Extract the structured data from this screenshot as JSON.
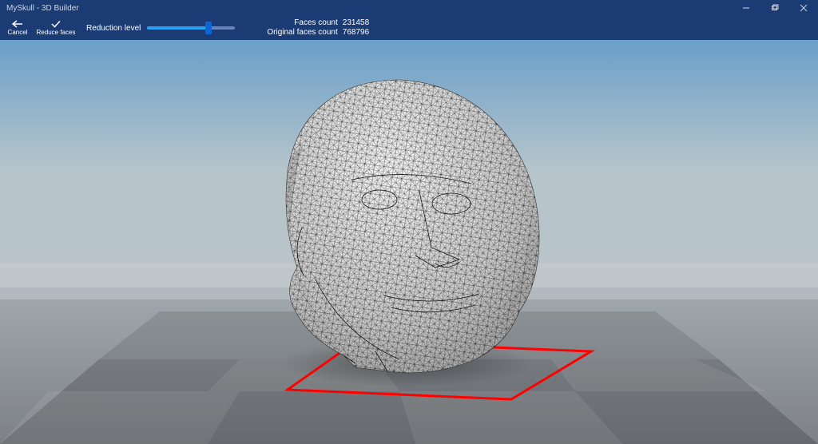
{
  "window": {
    "title": "MySkull - 3D Builder"
  },
  "toolbar": {
    "cancel_label": "Cancel",
    "accept_label": "Reduce faces",
    "slider_label": "Reduction level",
    "slider_percent": 70
  },
  "stats": {
    "faces_label": "Faces count",
    "faces_value": "231458",
    "original_label": "Original faces count",
    "original_value": "768796"
  },
  "scene": {
    "sky_top": "#6a9fc9",
    "sky_bottom": "#b7c5cb",
    "ground_near": "#8d9196",
    "ground_far": "#a7afb4",
    "bbox_color": "#ff0000"
  }
}
